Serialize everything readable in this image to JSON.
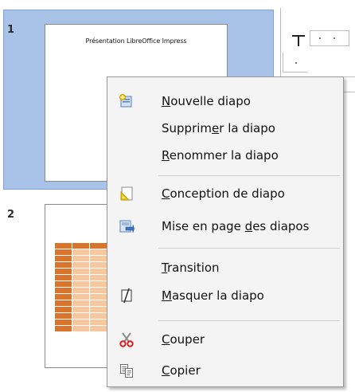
{
  "slides": [
    {
      "number": "1",
      "title": "Présentation LibreOffice Impress"
    },
    {
      "number": "2"
    }
  ],
  "menu": {
    "items": [
      {
        "label": "Nouvelle diapo",
        "mnemonic": "N",
        "icon": "new-slide-icon"
      },
      {
        "label": "Supprimer la diapo",
        "mnemonic": "e",
        "icon": ""
      },
      {
        "label": "Renommer la diapo",
        "mnemonic": "R",
        "icon": ""
      },
      {
        "label": "Conception de diapo",
        "mnemonic": "C",
        "icon": "slide-design-icon"
      },
      {
        "label": "Mise en page des diapos",
        "mnemonic": "d",
        "icon": "slide-layout-icon"
      },
      {
        "label": "Transition",
        "mnemonic": "T",
        "icon": ""
      },
      {
        "label": "Masquer la diapo",
        "mnemonic": "M",
        "icon": "hide-slide-icon"
      },
      {
        "label": "Couper",
        "mnemonic": "C",
        "icon": "scissors-icon"
      },
      {
        "label": "Copier",
        "mnemonic": "C",
        "icon": "copy-icon"
      }
    ]
  },
  "colors": {
    "selection": "#a9c3e8",
    "table_dark": "#d9742c",
    "table_light": "#f7c89f",
    "menu_bg": "#f4f4f4"
  }
}
